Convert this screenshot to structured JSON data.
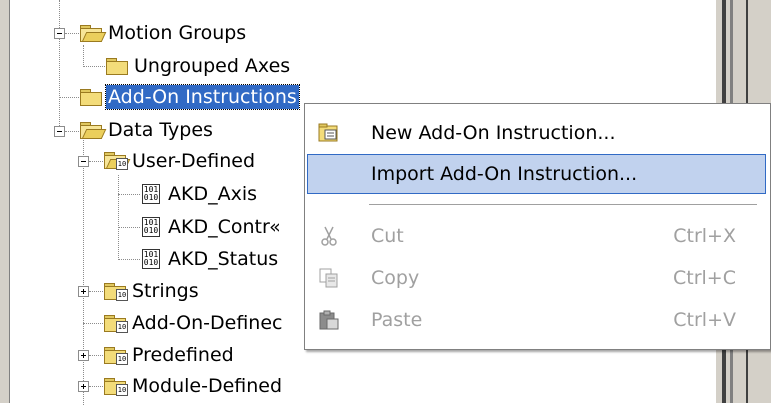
{
  "tree": {
    "motion_groups": "Motion Groups",
    "ungrouped_axes": "Ungrouped Axes",
    "add_on_instructions": "Add-On Instructions",
    "data_types": "Data Types",
    "user_defined": "User-Defined",
    "akd_axis": "AKD_Axis",
    "akd_control": "AKD_Contr«",
    "akd_status": "AKD_Status",
    "strings": "Strings",
    "add_on_defined": "Add-On-Definec",
    "predefined": "Predefined",
    "module_defined": "Module-Defined",
    "datatype_icon_text": "101\n010"
  },
  "menu": {
    "new_aoi": "New Add-On Instruction...",
    "import_aoi": "Import Add-On Instruction...",
    "cut": "Cut",
    "cut_shortcut": "Ctrl+X",
    "copy": "Copy",
    "copy_shortcut": "Ctrl+C",
    "paste": "Paste",
    "paste_shortcut": "Ctrl+V"
  },
  "colors": {
    "selection": "#316ac5",
    "menu_highlight": "#c1d2ee",
    "disabled_text": "#a0a0a0",
    "folder": "#f3dc7a"
  }
}
